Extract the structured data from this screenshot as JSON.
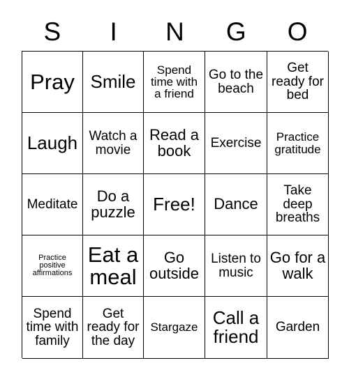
{
  "card": {
    "title_letters": [
      "S",
      "I",
      "N",
      "G",
      "O"
    ],
    "columns": 5,
    "rows": 5,
    "border_color": "#000000",
    "background_color": "#ffffff",
    "text_color": "#000000",
    "free_space_label": "Free!",
    "free_space_position": {
      "row": 3,
      "column": 3
    },
    "cells": [
      [
        {
          "text": "Pray",
          "size": "xxl"
        },
        {
          "text": "Smile",
          "size": "xl"
        },
        {
          "text": "Spend time with a friend",
          "size": "sm"
        },
        {
          "text": "Go to the beach",
          "size": "md"
        },
        {
          "text": "Get ready for bed",
          "size": "md"
        }
      ],
      [
        {
          "text": "Laugh",
          "size": "xl"
        },
        {
          "text": "Watch a movie",
          "size": "md"
        },
        {
          "text": "Read a book",
          "size": "lg"
        },
        {
          "text": "Exercise",
          "size": "md"
        },
        {
          "text": "Practice gratitude",
          "size": "sm"
        }
      ],
      [
        {
          "text": "Meditate",
          "size": "md"
        },
        {
          "text": "Do a puzzle",
          "size": "lg"
        },
        {
          "text": "Free!",
          "size": "xl"
        },
        {
          "text": "Dance",
          "size": "lg"
        },
        {
          "text": "Take deep breaths",
          "size": "md"
        }
      ],
      [
        {
          "text": "Practice positive affirmations",
          "size": "xxs"
        },
        {
          "text": "Eat a meal",
          "size": "xxl"
        },
        {
          "text": "Go outside",
          "size": "lg"
        },
        {
          "text": "Listen to music",
          "size": "md"
        },
        {
          "text": "Go for a walk",
          "size": "lg"
        }
      ],
      [
        {
          "text": "Spend time with family",
          "size": "md"
        },
        {
          "text": "Get ready for the day",
          "size": "md"
        },
        {
          "text": "Stargaze",
          "size": "sm"
        },
        {
          "text": "Call a friend",
          "size": "xl"
        },
        {
          "text": "Garden",
          "size": "md"
        }
      ]
    ]
  }
}
